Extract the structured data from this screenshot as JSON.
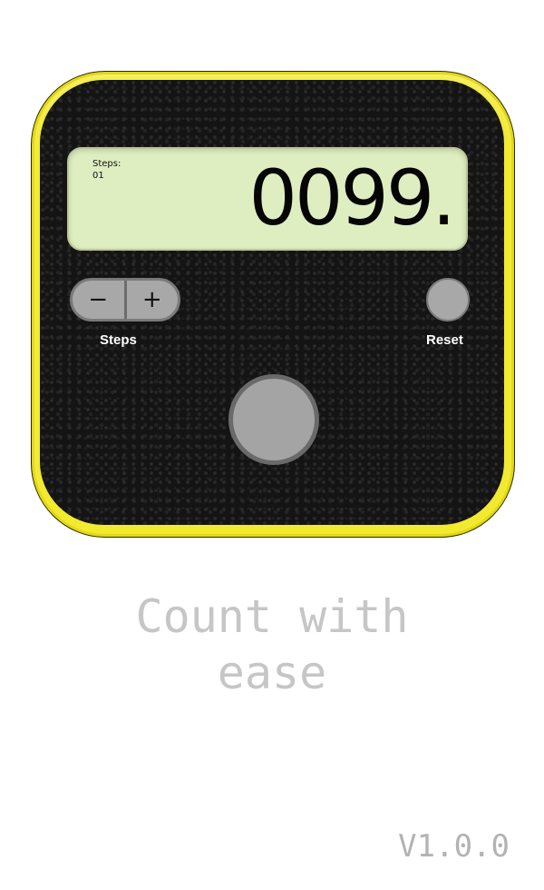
{
  "device": {
    "shell_color": "#f2ea2e",
    "face_color": "#141414",
    "display_color": "#dfeec0"
  },
  "display": {
    "steps_label": "Steps:",
    "steps_value": "01",
    "counter_value": "0099."
  },
  "controls": {
    "decrement_symbol": "−",
    "increment_symbol": "+",
    "steps_label": "Steps",
    "reset_label": "Reset",
    "count_button_icon": "count-button"
  },
  "tagline": {
    "line1": "Count with",
    "line2": "ease"
  },
  "version": "V1.0.0"
}
